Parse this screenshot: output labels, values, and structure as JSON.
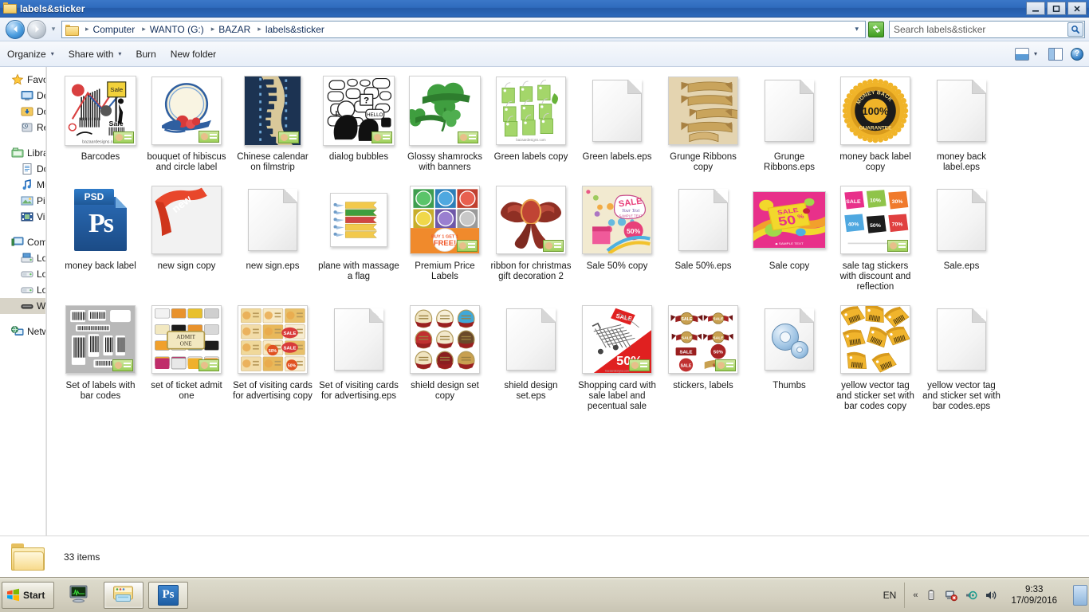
{
  "window": {
    "title": "labels&sticker",
    "icon": "folder-icon",
    "minimize_label": "–",
    "maximize_label": "□",
    "close_label": "✕"
  },
  "address_bar": {
    "back_label": "◀",
    "forward_label": "▶",
    "history_caret": "▾",
    "breadcrumbs": [
      "Computer",
      "WANTO (G:)",
      "BAZAR",
      "labels&sticker"
    ],
    "separator": "▸",
    "dropdown_caret": "▾",
    "refresh_label": "↺"
  },
  "search": {
    "placeholder": "Search labels&sticker",
    "value": "Search labels&sticker",
    "icon": "magnifier-icon"
  },
  "command_bar": {
    "items": [
      {
        "label": "Organize",
        "caret": "▾"
      },
      {
        "label": "Share with",
        "caret": "▾"
      },
      {
        "label": "Burn",
        "caret": ""
      },
      {
        "label": "New folder",
        "caret": ""
      }
    ],
    "view_caret": "▾",
    "help_label": "?"
  },
  "navigation_pane": {
    "groups": [
      {
        "header": {
          "label": "Favorites",
          "icon": "star-icon"
        },
        "items": [
          {
            "label": "Desktop",
            "icon": "desktop-icon"
          },
          {
            "label": "Downloads",
            "icon": "downloads-icon"
          },
          {
            "label": "Recent Places",
            "icon": "recent-places-icon"
          }
        ]
      },
      {
        "header": {
          "label": "Libraries",
          "icon": "libraries-icon"
        },
        "items": [
          {
            "label": "Documents",
            "icon": "documents-icon"
          },
          {
            "label": "Music",
            "icon": "music-icon"
          },
          {
            "label": "Pictures",
            "icon": "pictures-icon"
          },
          {
            "label": "Videos",
            "icon": "videos-icon"
          }
        ]
      },
      {
        "header": {
          "label": "Computer",
          "icon": "computer-icon"
        },
        "items": [
          {
            "label": "Local Disk (C:)",
            "icon": "system-drive-icon",
            "selected": false
          },
          {
            "label": "Local Disk (D:)",
            "icon": "drive-icon",
            "selected": false
          },
          {
            "label": "Local Disk (E:)",
            "icon": "drive-icon",
            "selected": false
          },
          {
            "label": "WANTO (G:)",
            "icon": "removable-drive-icon",
            "selected": true
          }
        ]
      },
      {
        "header": {
          "label": "Network",
          "icon": "network-icon"
        },
        "items": []
      }
    ]
  },
  "files": [
    {
      "name": "Barcodes",
      "kind": "thumb-barcodes",
      "overlay": true
    },
    {
      "name": "bouquet of hibiscus and circle label",
      "kind": "thumb-bouquet",
      "overlay": true
    },
    {
      "name": "Chinese calendar on filmstrip",
      "kind": "thumb-filmstrip",
      "overlay": true
    },
    {
      "name": "dialog bubbles",
      "kind": "thumb-bubbles",
      "overlay": true
    },
    {
      "name": "Glossy shamrocks with banners",
      "kind": "thumb-shamrock",
      "overlay": true
    },
    {
      "name": "Green labels copy",
      "kind": "thumb-greenlabels",
      "overlay": false
    },
    {
      "name": "Green labels.eps",
      "kind": "doc",
      "overlay": false
    },
    {
      "name": "Grunge Ribbons copy",
      "kind": "thumb-ribbons",
      "overlay": false
    },
    {
      "name": "Grunge Ribbons.eps",
      "kind": "doc",
      "overlay": false
    },
    {
      "name": "money back label copy",
      "kind": "thumb-moneyback",
      "overlay": false
    },
    {
      "name": "money back label.eps",
      "kind": "doc",
      "overlay": false
    },
    {
      "name": "money back label",
      "kind": "psd",
      "overlay": false
    },
    {
      "name": "new sign copy",
      "kind": "thumb-newsign",
      "overlay": false
    },
    {
      "name": "new sign.eps",
      "kind": "doc",
      "overlay": false
    },
    {
      "name": "plane with massage a flag",
      "kind": "thumb-flags",
      "overlay": false
    },
    {
      "name": "Premium Price Labels",
      "kind": "thumb-premium",
      "overlay": true
    },
    {
      "name": "ribbon for christmas gift decoration 2",
      "kind": "thumb-bow",
      "overlay": true
    },
    {
      "name": "Sale 50% copy",
      "kind": "thumb-sale50",
      "overlay": false
    },
    {
      "name": "Sale 50%.eps",
      "kind": "doc",
      "overlay": false
    },
    {
      "name": "Sale copy",
      "kind": "thumb-salepink",
      "overlay": false
    },
    {
      "name": "sale tag stickers with discount and reflection",
      "kind": "thumb-saletags",
      "overlay": true
    },
    {
      "name": "Sale.eps",
      "kind": "doc",
      "overlay": false
    },
    {
      "name": "Set of labels with bar codes",
      "kind": "thumb-barlabels",
      "overlay": true
    },
    {
      "name": "set of ticket admit one",
      "kind": "thumb-tickets",
      "overlay": true
    },
    {
      "name": "Set of visiting cards for advertising copy",
      "kind": "thumb-cards",
      "overlay": false
    },
    {
      "name": "Set of visiting cards for advertising.eps",
      "kind": "doc",
      "overlay": false
    },
    {
      "name": "shield design set copy",
      "kind": "thumb-shields",
      "overlay": false
    },
    {
      "name": "shield design set.eps",
      "kind": "doc",
      "overlay": false
    },
    {
      "name": "Shopping card with sale label and pecentual sale",
      "kind": "thumb-cart",
      "overlay": true
    },
    {
      "name": "stickers, labels",
      "kind": "thumb-redlabels",
      "overlay": true
    },
    {
      "name": "Thumbs",
      "kind": "gear-doc",
      "overlay": false
    },
    {
      "name": "yellow vector tag and sticker set with bar codes copy",
      "kind": "thumb-yellowtags",
      "overlay": false
    },
    {
      "name": "yellow vector tag and sticker set with bar codes.eps",
      "kind": "doc",
      "overlay": false
    }
  ],
  "status_bar": {
    "icon": "folder-icon",
    "item_count": "33 items"
  },
  "taskbar": {
    "start_label": "Start",
    "items": [
      {
        "name": "task-monitor",
        "icon": "monitor-icon",
        "active": false
      },
      {
        "name": "task-explorer",
        "icon": "explorer-folder-icon",
        "active": true
      },
      {
        "name": "task-photoshop",
        "icon": "photoshop-icon",
        "active": false,
        "label": "Ps"
      }
    ],
    "tray": {
      "language": "EN",
      "overflow_caret": "«",
      "icons": [
        "battery-icon",
        "network-error-icon",
        "sound-device-icon",
        "volume-icon"
      ],
      "time": "9:33",
      "date": "17/09/2016",
      "show_desktop": "show-desktop-button"
    }
  },
  "colors": {
    "titlebar": "#2f6bbd",
    "accent": "#1d5fa8",
    "selection": "#d8d4c8",
    "taskbar": "#d4d0c0",
    "green_refresh": "#3f9c20"
  }
}
